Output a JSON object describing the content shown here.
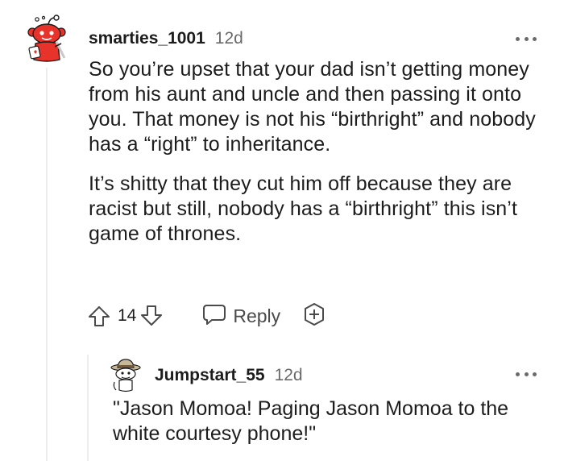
{
  "comment": {
    "username": "smarties_1001",
    "age": "12d",
    "paragraphs": [
      "So you’re upset that your dad isn’t getting money from his aunt and uncle and then passing it onto you. That money is not his “birthright” and nobody has a “right” to inheritance.",
      "It’s shitty that they cut him off because they are racist but still, nobody has a “birthright” this isn’t game of thrones."
    ],
    "score": "14",
    "reply_label": "Reply",
    "avatar_icon": "snoo-avatar-red-icon",
    "more_icon": "more-options-icon"
  },
  "reply": {
    "username": "Jumpstart_55",
    "age": "12d",
    "text": "\"Jason Momoa! Paging Jason Momoa to the white courtesy phone!\"",
    "avatar_icon": "snoo-avatar-explorer-icon",
    "more_icon": "more-options-icon"
  },
  "colors": {
    "text": "#1c1c1c",
    "muted": "#6a6a6a",
    "thread_line": "#ededed",
    "avatar_red": "#e8332a"
  }
}
